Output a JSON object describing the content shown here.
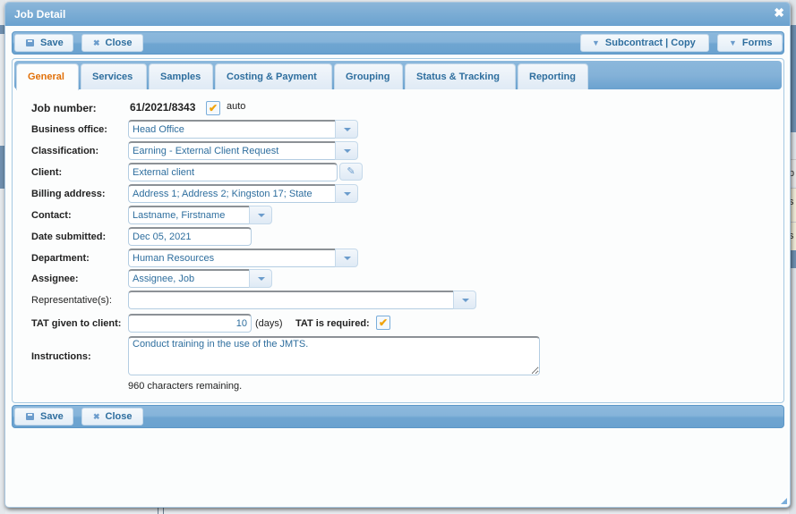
{
  "dialog": {
    "title": "Job Detail",
    "close_icon": "close-x-icon"
  },
  "toolbar_top": {
    "save_label": "Save",
    "close_label": "Close",
    "subcontract_label": "Subcontract | Copy",
    "forms_label": "Forms"
  },
  "toolbar_bottom": {
    "save_label": "Save",
    "close_label": "Close"
  },
  "tabs": [
    {
      "label": "General",
      "active": true
    },
    {
      "label": "Services"
    },
    {
      "label": "Samples"
    },
    {
      "label": "Costing & Payment"
    },
    {
      "label": "Grouping"
    },
    {
      "label": "Status & Tracking"
    },
    {
      "label": "Reporting"
    }
  ],
  "form": {
    "job_number": {
      "label": "Job number:",
      "value": "61/2021/8343",
      "auto_checked": true,
      "auto_label": "auto"
    },
    "business_office": {
      "label": "Business office:",
      "value": "Head Office"
    },
    "classification": {
      "label": "Classification:",
      "value": "Earning - External Client Request"
    },
    "client": {
      "label": "Client:",
      "value": "External client"
    },
    "billing_address": {
      "label": "Billing address:",
      "value": "Address 1; Address 2; Kingston 17; State"
    },
    "contact": {
      "label": "Contact:",
      "value": "Lastname, Firstname"
    },
    "date_submitted": {
      "label": "Date submitted:",
      "value": "Dec 05, 2021"
    },
    "department": {
      "label": "Department:",
      "value": "Human Resources"
    },
    "assignee": {
      "label": "Assignee:",
      "value": "Assignee, Job"
    },
    "representatives": {
      "label": "Representative(s):",
      "value": ""
    },
    "tat": {
      "label": "TAT given to client:",
      "value": "10",
      "unit": "(days)",
      "required_label": "TAT is required:",
      "required_checked": true
    },
    "instructions": {
      "label": "Instructions:",
      "value": "Conduct training in the use of the JMTS.",
      "remaining": "960 characters remaining."
    }
  },
  "colors": {
    "header_blue": "#6aa2cf",
    "active_tab_text": "#e17009",
    "button_text": "#2e6e9e",
    "check_mark": "#f0a30a"
  }
}
